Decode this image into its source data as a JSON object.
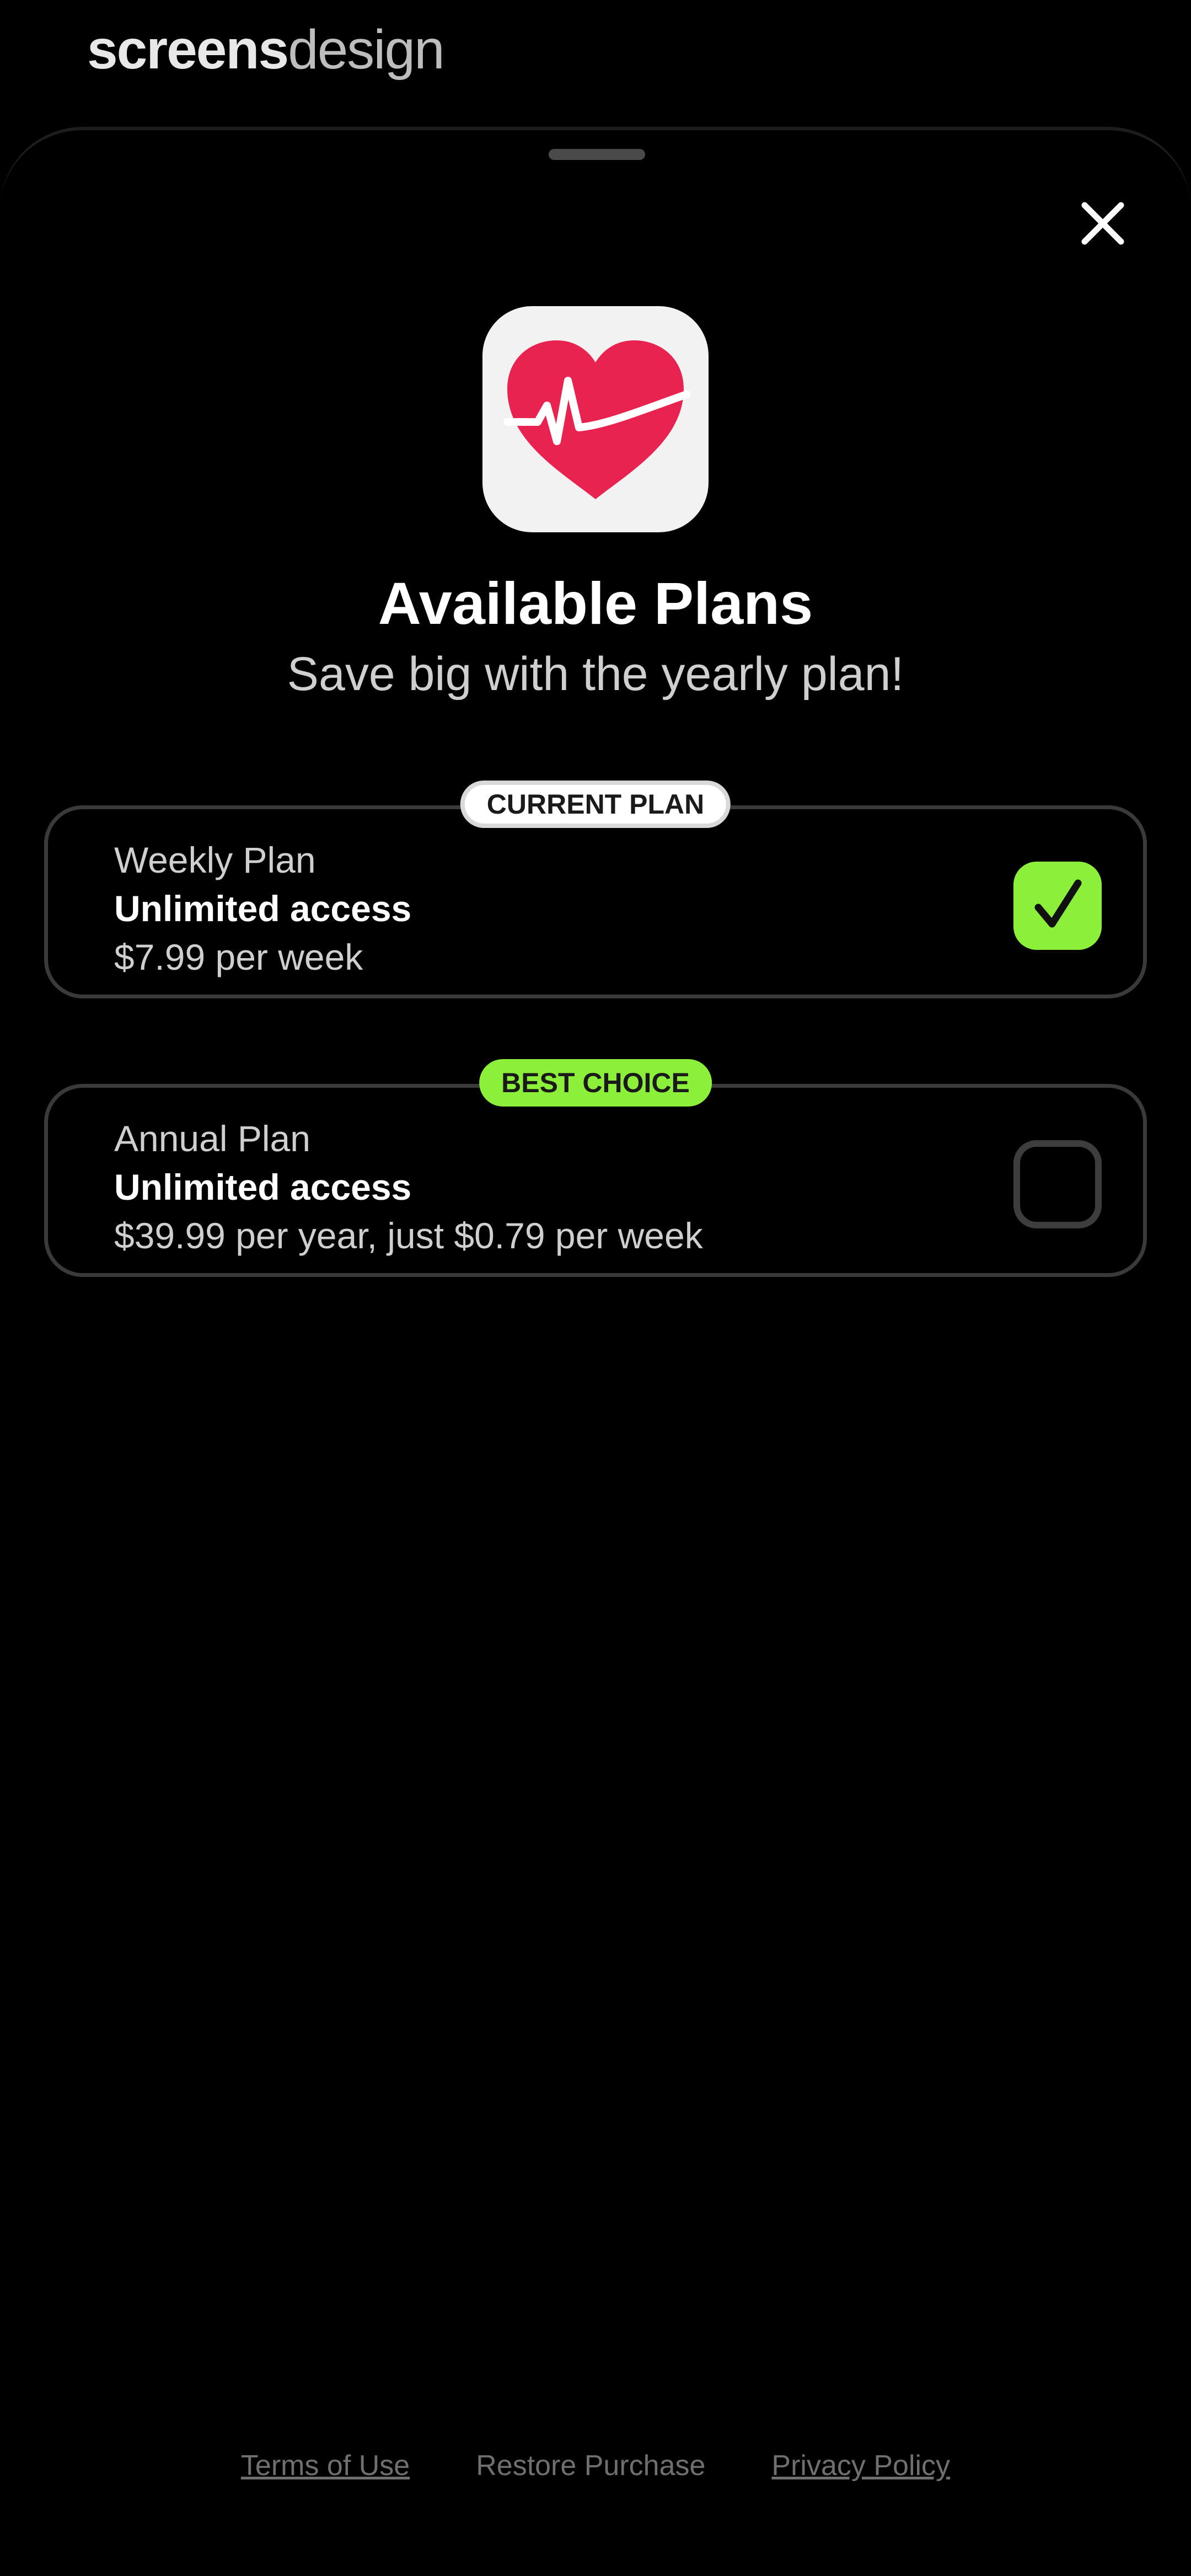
{
  "watermark": {
    "bold": "screens",
    "light": "design"
  },
  "header": {
    "close_icon": "close-icon"
  },
  "app": {
    "icon": "heart-pulse-icon",
    "colors": {
      "heart": "#e8234f",
      "tile": "#f2f2f2"
    }
  },
  "title": "Available Plans",
  "subtitle": "Save big with the yearly plan!",
  "plans": [
    {
      "badge": "CURRENT PLAN",
      "name": "Weekly Plan",
      "access": "Unlimited access",
      "price": "$7.99 per week",
      "selected": true
    },
    {
      "badge": "BEST CHOICE",
      "name": "Annual Plan",
      "access": "Unlimited access",
      "price": "$39.99 per year, just $0.79 per week",
      "selected": false
    }
  ],
  "footer": {
    "terms": "Terms of Use",
    "restore": "Restore Purchase",
    "privacy": "Privacy Policy"
  },
  "colors": {
    "accent": "#8cf03a",
    "background": "#000000"
  }
}
